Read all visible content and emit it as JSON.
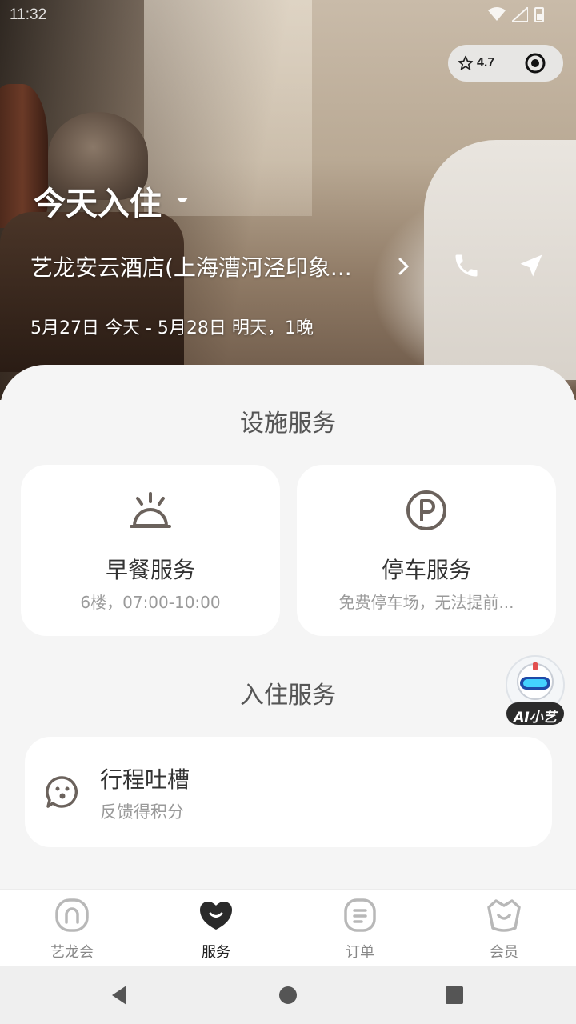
{
  "status_bar": {
    "time": "11:32"
  },
  "mini_program": {
    "rating": "4.7"
  },
  "hero": {
    "checkin_label": "今天入住",
    "hotel_name": "艺龙安云酒店(上海漕河泾印象...",
    "dates": "5月27日 今天 - 5月28日 明天，1晚"
  },
  "facility_section": {
    "title": "设施服务",
    "items": [
      {
        "name": "早餐服务",
        "desc": "6楼，07:00-10:00",
        "icon": "breakfast-bell-icon"
      },
      {
        "name": "停车服务",
        "desc": "免费停车场，无法提前...",
        "icon": "parking-icon"
      }
    ]
  },
  "checkin_section": {
    "title": "入住服务",
    "items": [
      {
        "name": "行程吐槽",
        "desc": "反馈得积分",
        "icon": "speech-face-icon"
      }
    ]
  },
  "ai_assistant": {
    "label": "AI小艺"
  },
  "tabbar": {
    "items": [
      {
        "label": "艺龙会",
        "icon": "home-arch-icon",
        "active": false
      },
      {
        "label": "服务",
        "icon": "heart-smile-icon",
        "active": true
      },
      {
        "label": "订单",
        "icon": "order-icon",
        "active": false
      },
      {
        "label": "会员",
        "icon": "member-basket-icon",
        "active": false
      }
    ]
  },
  "colors": {
    "accent": "#222222",
    "muted": "#888888",
    "bg": "#f5f5f5"
  }
}
